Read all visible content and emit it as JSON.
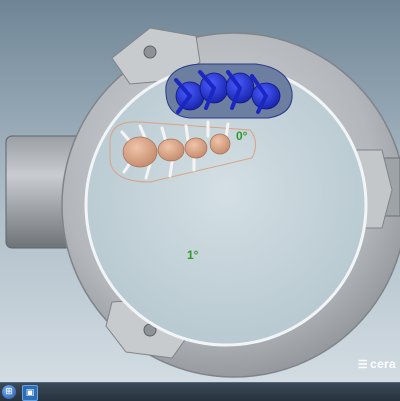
{
  "viewport": {
    "angle_top": "0°",
    "angle_bottom": "1°"
  },
  "brand": {
    "logo_text": "cera"
  },
  "taskbar": {
    "start_icon": "windows-orb-icon",
    "app_icon": "cad-app-icon"
  },
  "colors": {
    "background_top": "#6f8596",
    "ring": "#b8bcc0",
    "disc": "#c4d3da",
    "tooth": "#d9a386",
    "support": "#f1f1f1",
    "part_blue": "#2233cc",
    "label_green": "#2f9a2a"
  }
}
